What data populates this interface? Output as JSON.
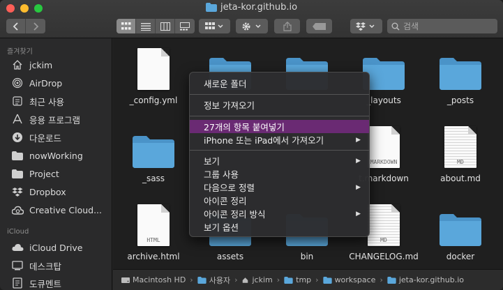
{
  "window": {
    "title": "jeta-kor.github.io"
  },
  "toolbar": {
    "back": "back",
    "forward": "forward",
    "search_placeholder": "검색"
  },
  "sidebar": {
    "favorites_header": "즐겨찾기",
    "favorites": [
      {
        "label": "jckim",
        "icon": "home-icon"
      },
      {
        "label": "AirDrop",
        "icon": "airdrop-icon"
      },
      {
        "label": "최근 사용",
        "icon": "clock-icon"
      },
      {
        "label": "응용 프로그램",
        "icon": "applications-icon"
      },
      {
        "label": "다운로드",
        "icon": "download-icon"
      },
      {
        "label": "nowWorking",
        "icon": "folder-icon"
      },
      {
        "label": "Project",
        "icon": "folder-icon"
      },
      {
        "label": "Dropbox",
        "icon": "dropbox-icon"
      },
      {
        "label": "Creative Cloud...",
        "icon": "creative-cloud-icon"
      }
    ],
    "icloud_header": "iCloud",
    "icloud": [
      {
        "label": "iCloud Drive",
        "icon": "cloud-icon"
      },
      {
        "label": "데스크탑",
        "icon": "desktop-icon"
      },
      {
        "label": "도큐멘트",
        "icon": "document-icon"
      }
    ]
  },
  "files": [
    {
      "name": "_config.yml",
      "kind": "doc"
    },
    {
      "name": "",
      "kind": "folder"
    },
    {
      "name": "",
      "kind": "folder"
    },
    {
      "name": "_layouts",
      "kind": "folder"
    },
    {
      "name": "_posts",
      "kind": "folder"
    },
    {
      "name": "_sass",
      "kind": "folder"
    },
    {
      "name": "t.markdown",
      "kind": "doc",
      "tag": "MARKDOWN"
    },
    {
      "name": "about.md",
      "kind": "doc",
      "tag": "MD"
    },
    {
      "name": "archive.html",
      "kind": "doc",
      "tag": "HTML"
    },
    {
      "name": "assets",
      "kind": "folder"
    },
    {
      "name": "bin",
      "kind": "folder"
    },
    {
      "name": "CHANGELOG.md",
      "kind": "doc",
      "tag": "MD"
    },
    {
      "name": "docker",
      "kind": "folder"
    }
  ],
  "context_menu": {
    "items": [
      {
        "label": "새로운 폴더",
        "submenu": false
      },
      {
        "label": "정보 가져오기",
        "submenu": false
      },
      {
        "label": "27개의 항목 붙여넣기",
        "submenu": false,
        "highlighted": true
      },
      {
        "label": "iPhone 또는 iPad에서 가져오기",
        "submenu": true
      },
      {
        "label": "보기",
        "submenu": true
      },
      {
        "label": "그룹 사용",
        "submenu": false
      },
      {
        "label": "다음으로 정렬",
        "submenu": true
      },
      {
        "label": "아이콘 정리",
        "submenu": false
      },
      {
        "label": "아이콘 정리 방식",
        "submenu": true
      },
      {
        "label": "보기 옵션",
        "submenu": false
      }
    ]
  },
  "pathbar": [
    "Macintosh HD",
    "사용자",
    "jckim",
    "tmp",
    "workspace",
    "jeta-kor.github.io"
  ],
  "colors": {
    "folder": "#5aa7db",
    "highlight": "#6a2a73",
    "window_bg": "#1f1f1f"
  }
}
